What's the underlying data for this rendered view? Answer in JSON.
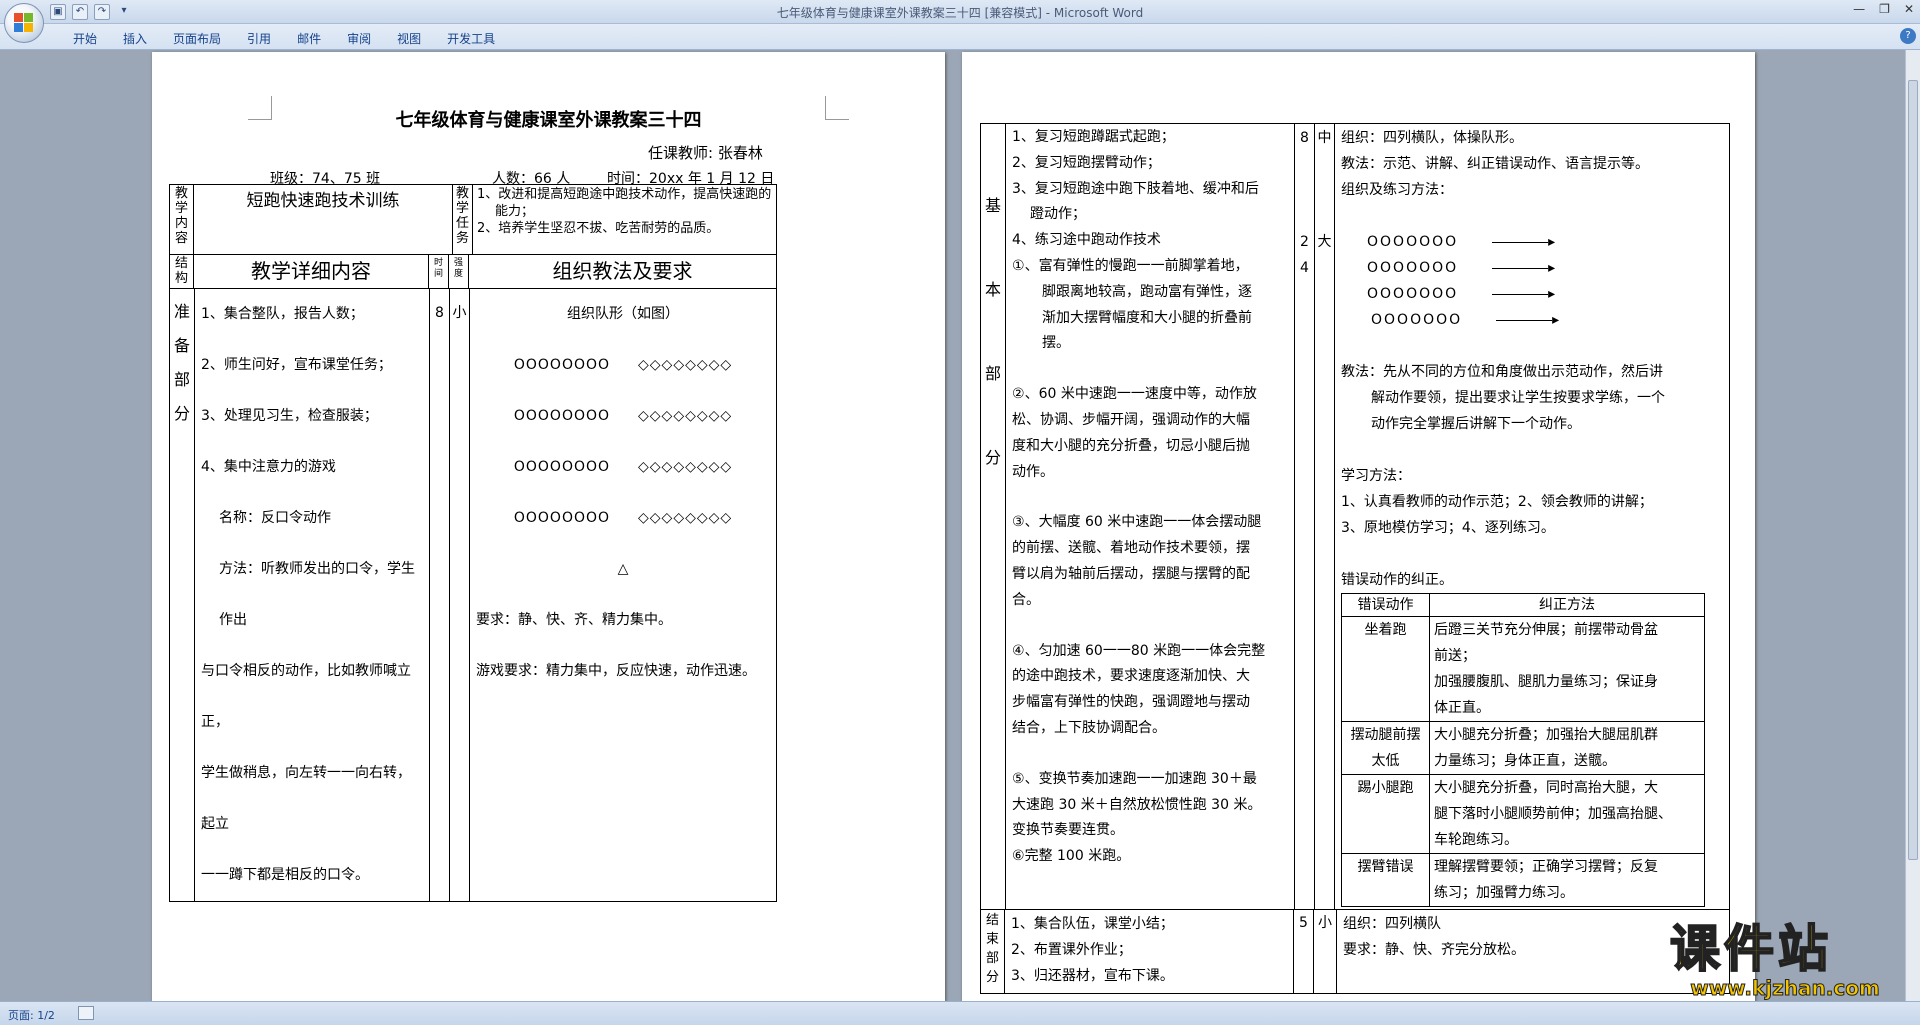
{
  "window": {
    "title": "七年级体育与健康课室外课教案三十四 [兼容模式] - Microsoft Word"
  },
  "ribbon": {
    "tabs": [
      "开始",
      "插入",
      "页面布局",
      "引用",
      "邮件",
      "审阅",
      "视图",
      "开发工具"
    ]
  },
  "status": {
    "page": "页面: 1/2"
  },
  "page1": {
    "title": "七年级体育与健康课室外课教案三十四",
    "teacher": "任课教师: 张春林",
    "class_info": "班级：74、75 班",
    "headcount": "人数：66 人",
    "date": "时间：20xx 年 1 月 12 日",
    "content_label": "教学内容",
    "content_title": "短跑快速跑技术训练",
    "task_label": "教学任务",
    "tasks": [
      "1、改进和提高短跑途中跑技术动作，提高快速跑的",
      "能力；",
      "2、培养学生坚忍不拔、吃苦耐劳的品质。"
    ],
    "struct_label": "结构",
    "detail_header": "教学详细内容",
    "time_label": "时间",
    "intensity_label": "强度",
    "method_header": "组织教法及要求",
    "section_label": [
      "准",
      "备",
      "部",
      "分"
    ],
    "items": [
      "1、集合整队，报告人数；",
      "2、师生问好，宣布课堂任务；",
      "3、处理见习生，检查服装；",
      "4、集中注意力的游戏",
      "名称：反口令动作",
      "方法：听教师发出的口令，学生作出",
      "与口令相反的动作，比如教师喊立正，",
      "学生做稍息，向左转一一向右转，起立",
      "一一蹲下都是相反的口令。"
    ],
    "time": "8",
    "intensity": "小",
    "formation_title": "组织队形（如图）",
    "circles": "OOOOOOOO",
    "diamonds": "◇◇◇◇◇◇◇◇",
    "teacher_mark": "△",
    "requirement": "要求：静、快、齐、精力集中。",
    "game_requirement": "游戏要求：精力集中，反应快速，动作迅速。"
  },
  "page2": {
    "basic_label": [
      "基",
      "本",
      "部",
      "分"
    ],
    "basic_items": [
      "1、复习短跑蹲踞式起跑；",
      "2、复习短跑摆臂动作；",
      "3、复习短跑途中跑下肢着地、缓冲和后",
      "蹬动作；",
      "4、练习途中跑动作技术",
      "①、富有弹性的慢跑一一前脚掌着地，",
      "脚跟离地较高，跑动富有弹性，逐",
      "渐加大摆臂幅度和大小腿的折叠前",
      "摆。",
      "②、60 米中速跑一一速度中等，动作放",
      "松、协调、步幅开阔，强调动作的大幅",
      "度和大小腿的充分折叠，切忌小腿后抛",
      "动作。",
      "③、大幅度 60 米中速跑一一体会摆动腿",
      "的前摆、送髋、着地动作技术要领，摆",
      "臂以肩为轴前后摆动，摆腿与摆臂的配",
      "合。",
      "④、匀加速 60一一80 米跑一一体会完整",
      "的途中跑技术，要求速度逐渐加快、大",
      "步幅富有弹性的快跑，强调蹬地与摆动",
      "结合，上下肢协调配合。",
      "⑤、变换节奏加速跑一一加速跑 30＋最",
      "大速跑 30 米＋自然放松惯性跑 30 米。",
      "变换节奏要连贯。",
      "⑥完整 100 米跑。"
    ],
    "times": [
      "8",
      "2",
      "4"
    ],
    "intensities": [
      "中",
      "大"
    ],
    "org": [
      "组织：四列横队，体操队形。",
      "教法：示范、讲解、纠正错误动作、语言提示等。",
      "组织及练习方法："
    ],
    "rows_circles": "OOOOOOO",
    "method_text": [
      "教法：先从不同的方位和角度做出示范动作，然后讲",
      "解动作要领，提出要求让学生按要求学练，一个",
      "动作完全掌握后讲解下一个动作。"
    ],
    "learn_title": "学习方法：",
    "learn": [
      "1、认真看教师的动作示范；2、领会教师的讲解；",
      "3、原地模仿学习；4、逐列练习。"
    ],
    "error_title": "错误动作的纠正。",
    "error_table": {
      "headers": [
        "错误动作",
        "纠正方法"
      ],
      "rows": [
        {
          "error": "坐着跑",
          "fix": [
            "后蹬三关节充分伸展；前摆带动骨盆",
            "前送；",
            "加强腰腹肌、腿肌力量练习；保证身",
            "体正直。"
          ]
        },
        {
          "error": "摆动腿前摆太低",
          "fix": [
            "大小腿充分折叠；加强抬大腿屈肌群",
            "力量练习；身体正直，送髋。"
          ]
        },
        {
          "error": "踢小腿跑",
          "fix": [
            "大小腿充分折叠，同时高抬大腿，大",
            "腿下落时小腿顺势前伸；加强高抬腿、",
            "车轮跑练习。"
          ]
        },
        {
          "error": "摆臂错误",
          "fix": [
            "理解摆臂要领；正确学习摆臂；反复",
            "练习；加强臂力练习。"
          ]
        }
      ]
    },
    "end_label": [
      "结",
      "束",
      "部",
      "分"
    ],
    "end_items": [
      "1、集合队伍，课堂小结；",
      "2、布置课外作业；",
      "3、归还器材，宣布下课。"
    ],
    "end_time": "5",
    "end_intensity": "小",
    "end_org": [
      "组织：四列横队",
      "要求：静、快、齐完分放松。"
    ]
  },
  "watermark": {
    "text": "课件站",
    "url": "www.kjzhan.com"
  }
}
